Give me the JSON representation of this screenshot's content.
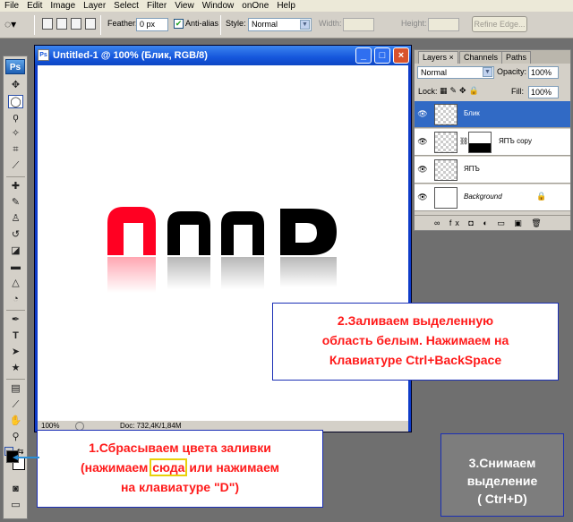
{
  "menu": [
    "File",
    "Edit",
    "Image",
    "Layer",
    "Select",
    "Filter",
    "View",
    "Window",
    "onOne",
    "Help"
  ],
  "options": {
    "feather_label": "Feather:",
    "feather_value": "0 px",
    "antialias_label": "Anti-alias",
    "antialias_checked": true,
    "style_label": "Style:",
    "style_value": "Normal",
    "width_label": "Width:",
    "height_label": "Height:",
    "refine_edge": "Refine Edge..."
  },
  "toolbox": {
    "logo": "Ps"
  },
  "document": {
    "title": "Untitled-1 @ 100% (Блик, RGB/8)",
    "zoom": "100%",
    "doc_info": "Doc: 732,4K/1,84M",
    "window_buttons": {
      "minimize": "_",
      "restore": "□",
      "close": "×"
    }
  },
  "layers_panel": {
    "tabs": [
      "Layers ×",
      "Channels",
      "Paths"
    ],
    "blend_mode": "Normal",
    "opacity_label": "Opacity:",
    "opacity_value": "100%",
    "lock_label": "Lock:",
    "fill_label": "Fill:",
    "fill_value": "100%",
    "layers": [
      {
        "name": "Блик",
        "selected": true
      },
      {
        "name": "ЯПЪ copy",
        "selected": false
      },
      {
        "name": "ЯПЪ",
        "selected": false
      },
      {
        "name": "Background",
        "selected": false
      }
    ],
    "bottom_icons": "∞ fx ◘ ◐ ▭ ▣ 🗑"
  },
  "annotations": {
    "step1_line1": "1.Сбрасываем цвета заливки",
    "step1_line2_a": "(нажимаем ",
    "step1_line2_highlight": "сюда",
    "step1_line2_b": " или нажимаем",
    "step1_line3": "на клавиатуре \"D\")",
    "step2_line1": "2.Заливаем выделенную",
    "step2_line2": "область белым. Нажимаем на",
    "step2_line3": "Клавиатуре Ctrl+BackSpace",
    "step3_line1": "3.Снимаем",
    "step3_line2": "выделение",
    "step3_line3": "( Ctrl+D)"
  },
  "colors": {
    "red_letter": "#ff0022",
    "black_letter": "#000000",
    "title_blue": "#1556dc",
    "annotation_red": "#ff1a1a"
  }
}
